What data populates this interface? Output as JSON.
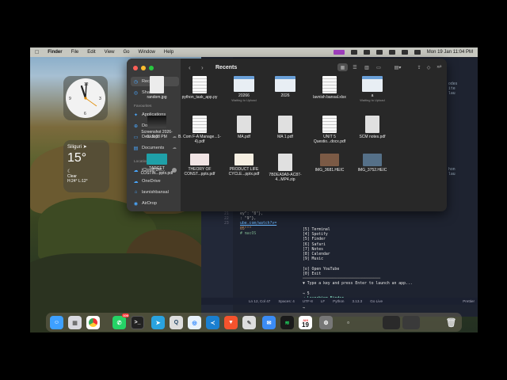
{
  "menubar": {
    "apple_label": "",
    "app": "Finder",
    "items": [
      "File",
      "Edit",
      "View",
      "Go",
      "Window",
      "Help"
    ],
    "datetime": "Mon 19 Jan  11:04 PM"
  },
  "widgets": {
    "weather": {
      "city": "Siliguri",
      "temp": "15°",
      "condition": "Clear",
      "range": "H:24° L:12°"
    }
  },
  "finder": {
    "title": "Recents",
    "sidebar": {
      "top": [
        {
          "label": "Recents",
          "icon": "clock-icon"
        },
        {
          "label": "Shared",
          "icon": "shared-icon"
        }
      ],
      "favourites_heading": "Favourites",
      "favourites": [
        {
          "label": "Applications",
          "icon": "applications-icon"
        },
        {
          "label": "Downloads",
          "icon": "downloads-icon"
        },
        {
          "label": "Desktop",
          "icon": "desktop-icon"
        },
        {
          "label": "Documents",
          "icon": "documents-icon"
        }
      ],
      "locations_heading": "Locations",
      "locations": [
        {
          "label": "iCloud Dri...",
          "icon": "cloud-icon"
        },
        {
          "label": "OneDrive",
          "icon": "onedrive-icon"
        },
        {
          "label": "lavnishbansal",
          "icon": "home-icon"
        },
        {
          "label": "AirDrop",
          "icon": "airdrop-icon"
        }
      ]
    },
    "files": [
      {
        "name": "random.jpg",
        "sub": "",
        "kind": "img"
      },
      {
        "name": "python_task_app.py",
        "sub": "",
        "kind": "doc"
      },
      {
        "name": "20266",
        "sub": "Waiting to Upload",
        "kind": "sheet"
      },
      {
        "name": "2026",
        "sub": "",
        "kind": "sheet"
      },
      {
        "name": "lavnish bansal.xlsx",
        "sub": "",
        "kind": "doc"
      },
      {
        "name": "a",
        "sub": "Waiting to Upload",
        "kind": "sheet"
      },
      {
        "name": "Screenshot 2026-0...9.08 PM",
        "sub": "",
        "kind": "shot"
      },
      {
        "name": "B. Com F-A Manage...1-4).pdf",
        "sub": "",
        "kind": "doc"
      },
      {
        "name": "MA.pdf",
        "sub": "",
        "kind": "pdf"
      },
      {
        "name": "MA 1.pdf",
        "sub": "",
        "kind": "pdf"
      },
      {
        "name": "UNIT 5 Questio...docx.pdf",
        "sub": "",
        "kind": "doc"
      },
      {
        "name": "SCM notes.pdf",
        "sub": "",
        "kind": "pdf"
      },
      {
        "name": "TARGET COSTIN...pptx.pdf",
        "sub": "",
        "kind": "card"
      },
      {
        "name": "THEORY OF CONST...pptx.pdf",
        "sub": "",
        "kind": "slide"
      },
      {
        "name": "PRODUCT LIFE CYCLE...pptx.pdf",
        "sub": "",
        "kind": "slide2"
      },
      {
        "name": "7BDEA9A9-AC87-4...MP4.zip",
        "sub": "",
        "kind": "pdf"
      },
      {
        "name": "IMG_3681.HEIC",
        "sub": "",
        "kind": "photo"
      },
      {
        "name": "IMG_3752.HEIC",
        "sub": "",
        "kind": "photo2"
      }
    ]
  },
  "editor": {
    "code_lines": [
      "ey\": \"8\"},",
      ": \"9\"},",
      "",
      "",
      "ube.com/watch?v=",
      "",
      "",
      "05\"\"\"",
      "",
      "",
      "# macOS"
    ],
    "line_numbers": [
      "21",
      "22",
      "23"
    ],
    "right_fragments": [
      "odes",
      "ite",
      "lau",
      "",
      "",
      "",
      "",
      "",
      "hon",
      "lau"
    ],
    "terminal_lines": [
      "[5] Terminal",
      "[4] Spotify",
      "[5] Finder",
      "[6] Safari",
      "[7] Notes",
      "[8] Calendar",
      "[9] Music",
      "",
      "[o] Open YouTube",
      "[0] Exit",
      "",
      "▼ Type a key and press Enter to launch an app...",
      "",
      "→ 5",
      "✔ Launching Finder...",
      "✔ Opened: Finder",
      "→"
    ],
    "status": {
      "position": "Ln 12, Col 47",
      "spaces": "Spaces: 4",
      "encoding": "UTF-8",
      "eol": "LF",
      "language": "Python",
      "version": "3.13.3",
      "golive": "Go Live",
      "prettier": "Prettier"
    }
  },
  "dock": {
    "calendar_month": "JAN",
    "calendar_day": "19",
    "whatsapp_badge": "100",
    "apps": [
      "finder-icon",
      "launchpad-icon",
      "chrome-icon",
      "whatsapp-icon",
      "terminal-icon",
      "telegram-icon",
      "quicktime-icon",
      "safari-icon",
      "vscode-icon",
      "brave-icon",
      "notes-icon",
      "mail-icon",
      "spotify-icon",
      "calendar-icon",
      "settings-icon",
      "window-icon",
      "window2-icon",
      "trash-icon"
    ]
  }
}
